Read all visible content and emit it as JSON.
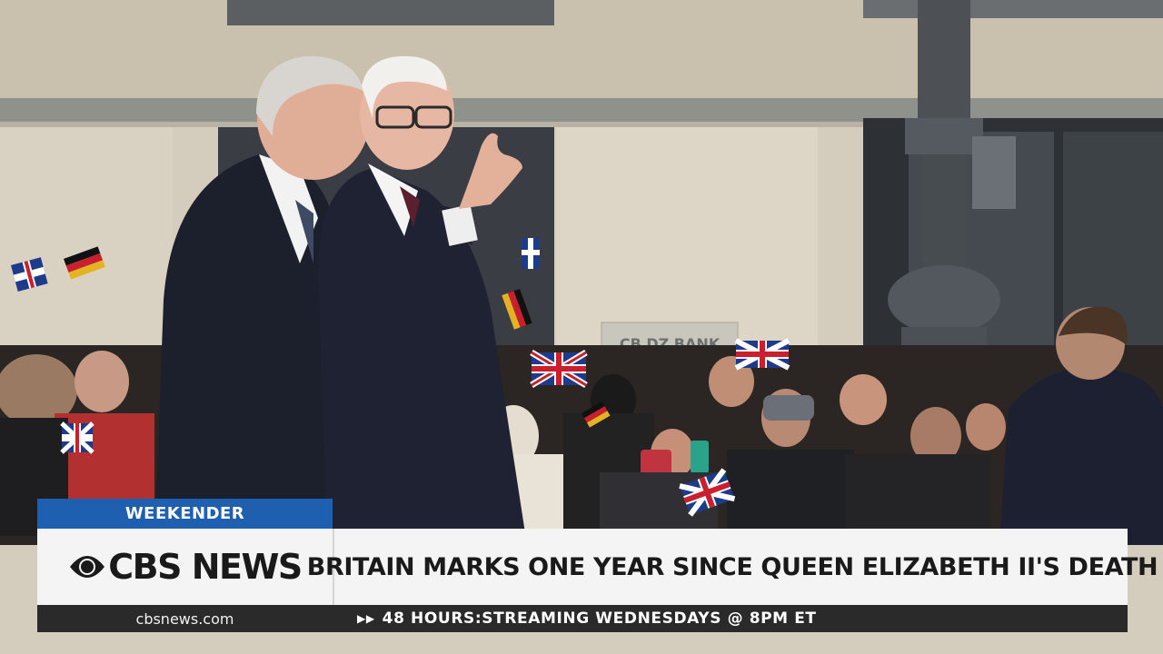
{
  "lower_third": {
    "show_tab": "WEEKENDER",
    "brand": "CBS NEWS",
    "headline": "BRITAIN MARKS ONE YEAR SINCE QUEEN ELIZABETH II'S DEATH",
    "url": "cbsnews.com",
    "ticker_arrows": "▶▶",
    "ticker": "48 HOURS:STREAMING WEDNESDAYS @ 8PM ET"
  },
  "scene": {
    "sign_text": "CB DZ BANK"
  },
  "colors": {
    "show_tab_blue": "#1f5fb0",
    "bar_light": "#f4f4f4",
    "ticker_dark": "#2a2a2a",
    "coat_navy": "#1c1f2c",
    "building_stone": "#d8d2c2"
  }
}
